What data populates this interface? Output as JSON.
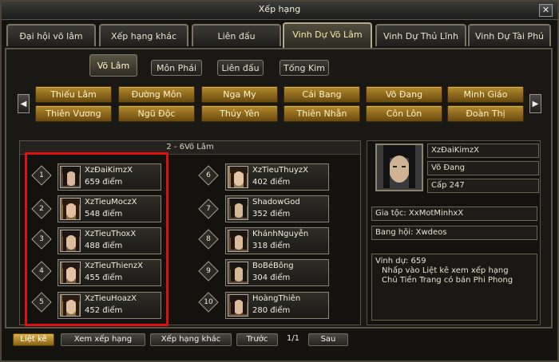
{
  "window": {
    "title": "Xếp hạng",
    "close_label": "✕"
  },
  "tabs": [
    "Đại hội võ lâm",
    "Xếp hạng khác",
    "Liên đấu",
    "Vinh Dự Võ Lâm",
    "Vinh Dự Thủ Lĩnh",
    "Vinh Dự Tài Phú"
  ],
  "subtabs": [
    "Võ Lâm",
    "Môn Phái",
    "Liên đấu",
    "Tống Kim"
  ],
  "sects_row1": [
    "Thiếu Lâm",
    "Đường Môn",
    "Nga My",
    "Cái Bang",
    "Võ Đang",
    "Minh Giáo"
  ],
  "sects_row2": [
    "Thiên Vương",
    "Ngũ Độc",
    "Thúy Yên",
    "Thiên Nhẫn",
    "Côn Lôn",
    "Đoàn Thị"
  ],
  "arrows": {
    "left": "◀",
    "right": "▶"
  },
  "ranking": {
    "header": "2 - 6Võ Lâm",
    "entries": [
      {
        "rank": "1",
        "name": "XzĐaiKimzX",
        "score": "659 điểm"
      },
      {
        "rank": "2",
        "name": "XzTieuMoczX",
        "score": "548 điểm"
      },
      {
        "rank": "3",
        "name": "XzTieuThoxX",
        "score": "488 điểm"
      },
      {
        "rank": "4",
        "name": "XzTieuThienzX",
        "score": "455 điểm"
      },
      {
        "rank": "5",
        "name": "XzTieuHoazX",
        "score": "452 điểm"
      },
      {
        "rank": "6",
        "name": "XzTieuThuyzX",
        "score": "402 điểm"
      },
      {
        "rank": "7",
        "name": "ShadowGod",
        "score": "352 điểm"
      },
      {
        "rank": "8",
        "name": "KhánhNguyễn",
        "score": "318 điểm"
      },
      {
        "rank": "9",
        "name": "BoBéBông",
        "score": "304 điểm"
      },
      {
        "rank": "10",
        "name": "HoàngThiên",
        "score": "280 điểm"
      }
    ]
  },
  "profile": {
    "name": "XzĐaiKimzX",
    "sect": "Võ Đang",
    "level": "Cấp 247",
    "family": "Gia tộc: XxMotMinhxX",
    "guild": "Bang hội: Xwdeos",
    "description": [
      "Vinh dự: 659",
      "  Nhấp vào Liệt kê xem xếp hạng",
      "  Chủ Tiền Trang có bán Phi Phong"
    ]
  },
  "footer": {
    "list": "Liệt kê",
    "view": "Xem xếp hạng",
    "other": "Xếp hạng khác",
    "prev": "Trước",
    "page": "1/1",
    "next": "Sau"
  },
  "colors": {
    "highlight": "#e01010",
    "gold": "#b48a2c"
  }
}
